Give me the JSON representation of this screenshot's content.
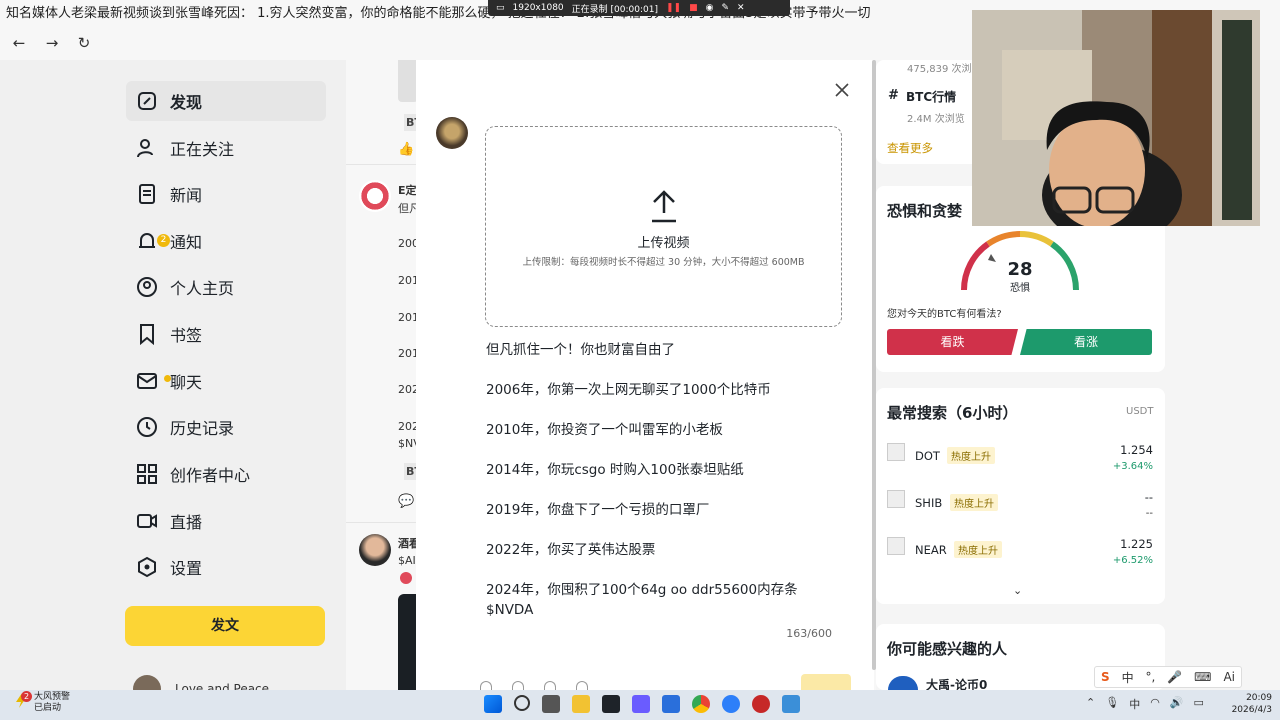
{
  "window": {
    "title": "知名媒体人老梁最新视频谈到张雪峰死因： 1.穷人突然变富，你的命格能不能那么硬， 把这杠住： 2.张雪峰借与大张嘴与宇宙曲3是以实带予带火一切",
    "recorder": {
      "resolution": "1920x1080",
      "status": "正在录制 [00:00:01]"
    }
  },
  "sidebar": {
    "items": [
      {
        "label": "发现",
        "icon": "discover-icon"
      },
      {
        "label": "正在关注",
        "icon": "following-icon"
      },
      {
        "label": "新闻",
        "icon": "news-icon"
      },
      {
        "label": "通知",
        "icon": "bell-icon",
        "badge": "2"
      },
      {
        "label": "个人主页",
        "icon": "profile-icon"
      },
      {
        "label": "书签",
        "icon": "bookmark-icon"
      },
      {
        "label": "聊天",
        "icon": "chat-icon"
      },
      {
        "label": "历史记录",
        "icon": "history-icon"
      },
      {
        "label": "创作者中心",
        "icon": "creator-icon"
      },
      {
        "label": "直播",
        "icon": "live-icon"
      },
      {
        "label": "设置",
        "icon": "settings-icon"
      }
    ],
    "post_button": "发文",
    "profile_name": "Love and Peace"
  },
  "feed": {
    "tag1": "BT",
    "post1_name": "E定",
    "post1_sub": "但凡",
    "years": [
      "200",
      "201",
      "201",
      "201",
      "202",
      "202"
    ],
    "post1_tail": "$NV",
    "tag2": "BT",
    "post2_name": "酒看",
    "post2_sub": "$AI"
  },
  "modal": {
    "upload_title": "上传视频",
    "upload_hint": "上传限制：每段视频时长不得超过 30 分钟，大小不得超过 600MB",
    "lines": [
      "但凡抓住一个！你也财富自由了",
      "2006年，你第一次上网无聊买了1000个比特币",
      "2010年，你投资了一个叫雷军的小老板",
      "2014年，你玩csgo 时购入100张泰坦贴纸",
      "2019年，你盘下了一个亏损的口罩厂",
      "2022年，你买了英伟达股票",
      "2024年，你囤积了100个64g oo ddr55600内存条",
      "$NVDA"
    ],
    "char_count": "163/600",
    "submit_label": "发文"
  },
  "right": {
    "top_views": "475,839 次浏览",
    "topic_name": "BTC行情",
    "topic_views": "2.4M 次浏览",
    "see_more": "查看更多",
    "fear_greed_title": "恐惧和贪婪",
    "fear_value": "28",
    "fear_label": "恐惧",
    "question": "您对今天的BTC有何看法?",
    "btn_down": "看跌",
    "btn_up": "看涨",
    "search_title": "最常搜索（6小时）",
    "search_unit": "USDT",
    "search_rows": [
      {
        "symbol": "DOT",
        "hot": "热度上升",
        "price": "1.254",
        "change": "+3.64%"
      },
      {
        "symbol": "SHIB",
        "hot": "热度上升",
        "price": "--",
        "change": "--"
      },
      {
        "symbol": "NEAR",
        "hot": "热度上升",
        "price": "1.225",
        "change": "+6.52%"
      }
    ],
    "people_title": "你可能感兴趣的人",
    "people_first": "大禹-论币0",
    "colors": {
      "down": "#d0314a",
      "up": "#1d9a6c",
      "brand": "#fcd535"
    }
  },
  "ime": [
    "中",
    "°,",
    "🎤",
    "⌨",
    "Ai"
  ],
  "taskbar": {
    "weather_badge": "2",
    "weather_title": "大风预警",
    "weather_sub": "已启动",
    "time": "20:09",
    "date": "2026/4/3"
  }
}
